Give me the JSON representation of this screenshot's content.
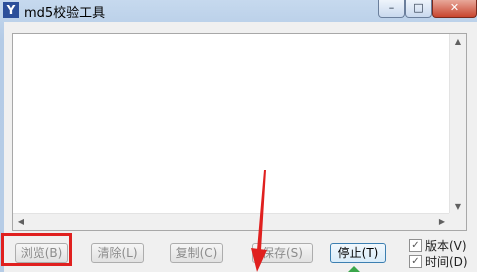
{
  "window": {
    "title": "md5校验工具",
    "app_icon": "Y",
    "minimize_glyph": "–",
    "maximize_glyph": "□",
    "close_glyph": "✕"
  },
  "output": {
    "scroll_up_glyph": "▲",
    "scroll_down_glyph": "▼",
    "scroll_left_glyph": "◀",
    "scroll_right_glyph": "▶"
  },
  "buttons": {
    "browse": "浏览(B)",
    "clear": "清除(L)",
    "copy": "复制(C)",
    "save": "保存(S)",
    "stop": "停止(T)"
  },
  "options": {
    "version_label": "版本(V)",
    "version_checked": true,
    "time_label": "时间(D)",
    "time_checked": true,
    "check_glyph": "✓"
  },
  "colors": {
    "highlight_box": "#e0201f",
    "annotation_arrow": "#e0201f"
  }
}
